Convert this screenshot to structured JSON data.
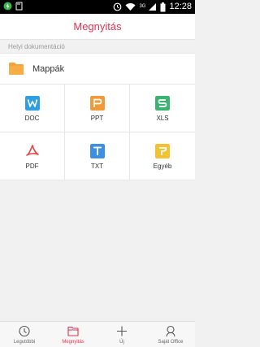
{
  "status_bar": {
    "network_label": "3G",
    "time": "12:28",
    "icons": [
      "battery-charging-icon",
      "sd-card-icon",
      "clock-icon",
      "wifi-icon",
      "signal-icon",
      "battery-icon"
    ]
  },
  "header": {
    "title": "Megnyitás"
  },
  "local_docs": {
    "section_label": "Helyi dokumentáció",
    "folder_label": "Mappák"
  },
  "file_types": [
    {
      "label": "DOC",
      "icon": "doc-icon",
      "color": "#2f9fe1"
    },
    {
      "label": "PPT",
      "icon": "ppt-icon",
      "color": "#f19a37"
    },
    {
      "label": "XLS",
      "icon": "xls-icon",
      "color": "#3cb371"
    },
    {
      "label": "PDF",
      "icon": "pdf-icon",
      "color": "#e64646"
    },
    {
      "label": "TXT",
      "icon": "txt-icon",
      "color": "#3c8fe2"
    },
    {
      "label": "Egyéb",
      "icon": "other-icon",
      "color": "#f2c230"
    }
  ],
  "bottom_nav": [
    {
      "label": "Legutóbbi",
      "icon": "recent-clock-icon",
      "active": false
    },
    {
      "label": "Megnyitás",
      "icon": "open-folder-icon",
      "active": true
    },
    {
      "label": "Új",
      "icon": "plus-icon",
      "active": false
    },
    {
      "label": "Saját Office",
      "icon": "user-icon",
      "active": false
    }
  ],
  "colors": {
    "accent": "#e2344f",
    "folder": "#f4a43c"
  }
}
